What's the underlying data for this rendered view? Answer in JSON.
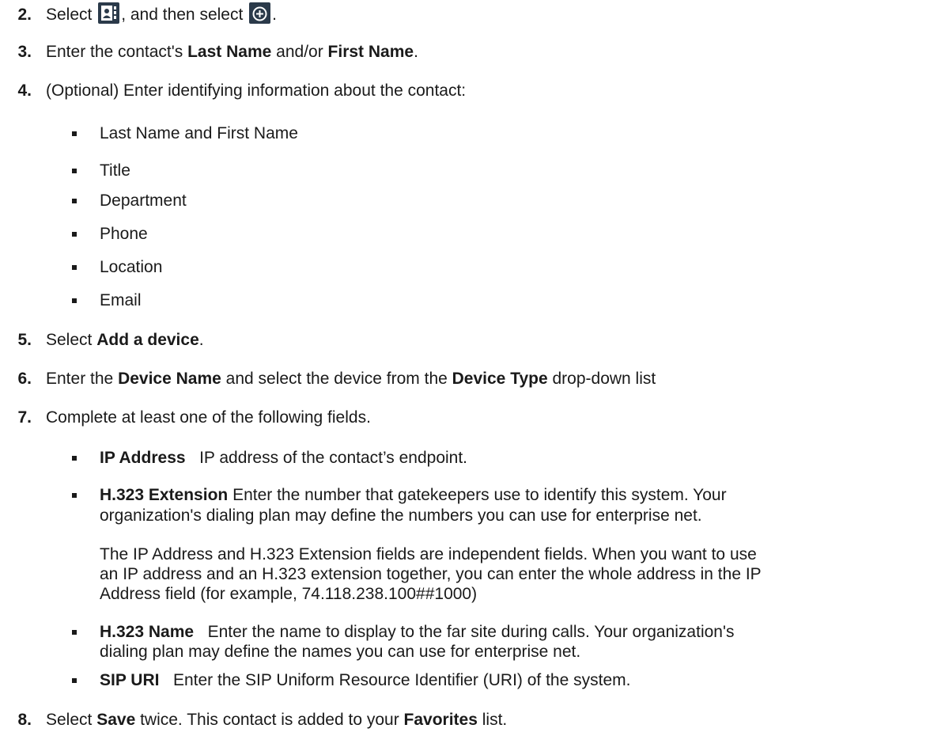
{
  "steps": {
    "s2": {
      "num": "2.",
      "prefix": "Select ",
      "middle": ", and then select ",
      "suffix": ".",
      "icon1": "contacts-icon",
      "icon2": "add-icon"
    },
    "s3": {
      "num": "3.",
      "a": "Enter the contact's ",
      "b1": "Last Name",
      "c": " and/or ",
      "b2": "First Name",
      "d": "."
    },
    "s4": {
      "num": "4.",
      "text": "(Optional) Enter identifying information about the contact:",
      "items": [
        "Last Name and First Name",
        "Title",
        "Department",
        "Phone",
        "Location",
        "Email"
      ]
    },
    "s5": {
      "num": "5.",
      "a": "Select ",
      "b": "Add a device",
      "c": "."
    },
    "s6": {
      "num": "6.",
      "a": "Enter the ",
      "b1": "Device Name",
      "c": " and select the device from the ",
      "b2": "Device Type",
      "d": " drop-down list"
    },
    "s7": {
      "num": "7.",
      "text": "Complete at least one of the following fields.",
      "ip_label": "IP Address",
      "ip_text": "   IP address of the contact’s endpoint.",
      "h323ext_label": "H.323 Extension",
      "h323ext_line1": " Enter the number that gatekeepers use to identify this system. Your",
      "h323ext_line2": "organization's dialing plan may define the numbers you can use for enterprise net.",
      "note_line1": "The IP Address and H.323 Extension fields are independent fields. When you want to use",
      "note_line2": "an IP address and an H.323 extension together, you can enter the whole address in the IP",
      "note_line3": "Address field (for example, 74.118.238.100##1000)",
      "h323name_label": "H.323 Name",
      "h323name_line1": "   Enter the name to display to the far site during calls. Your organization's",
      "h323name_line2": "dialing plan may define the names you can use for enterprise net.",
      "sip_label": "SIP URI",
      "sip_text": "   Enter the SIP Uniform Resource Identifier (URI) of the system."
    },
    "s8": {
      "num": "8.",
      "a": "Select ",
      "b1": "Save",
      "c": " twice. This contact is added to your ",
      "b2": "Favorites",
      "d": " list."
    }
  },
  "colors": {
    "text": "#1a1a1a",
    "icon_bg": "#2b3a4a"
  }
}
